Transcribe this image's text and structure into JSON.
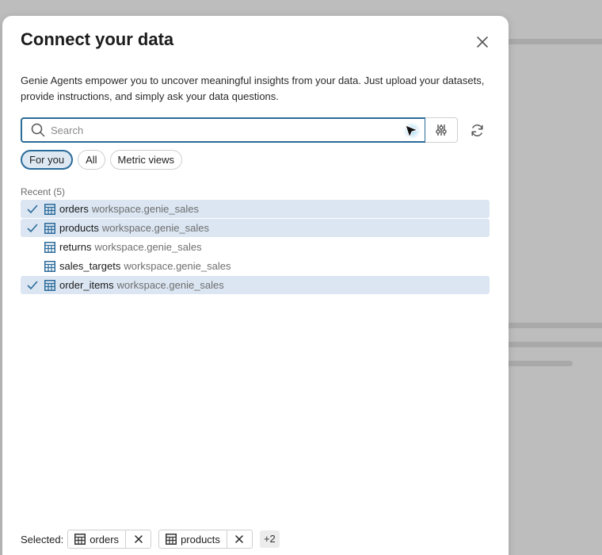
{
  "modal": {
    "title": "Connect your data",
    "description": "Genie Agents empower you to uncover meaningful insights from your data. Just upload your datasets, provide instructions, and simply ask your data questions."
  },
  "search": {
    "placeholder": "Search",
    "value": ""
  },
  "filters": [
    {
      "label": "For you",
      "active": true
    },
    {
      "label": "All",
      "active": false
    },
    {
      "label": "Metric views",
      "active": false
    }
  ],
  "recent": {
    "label": "Recent (5)",
    "items": [
      {
        "name": "orders",
        "schema": "workspace.genie_sales",
        "selected": true
      },
      {
        "name": "products",
        "schema": "workspace.genie_sales",
        "selected": true
      },
      {
        "name": "returns",
        "schema": "workspace.genie_sales",
        "selected": false
      },
      {
        "name": "sales_targets",
        "schema": "workspace.genie_sales",
        "selected": false
      },
      {
        "name": "order_items",
        "schema": "workspace.genie_sales",
        "selected": true
      }
    ]
  },
  "footer": {
    "label": "Selected:",
    "chips": [
      {
        "name": "orders"
      },
      {
        "name": "products"
      }
    ],
    "more": "+2"
  },
  "colors": {
    "accent": "#2b6b9a",
    "selected_row": "#dbe6f2",
    "active_pill": "#dde8f3"
  }
}
